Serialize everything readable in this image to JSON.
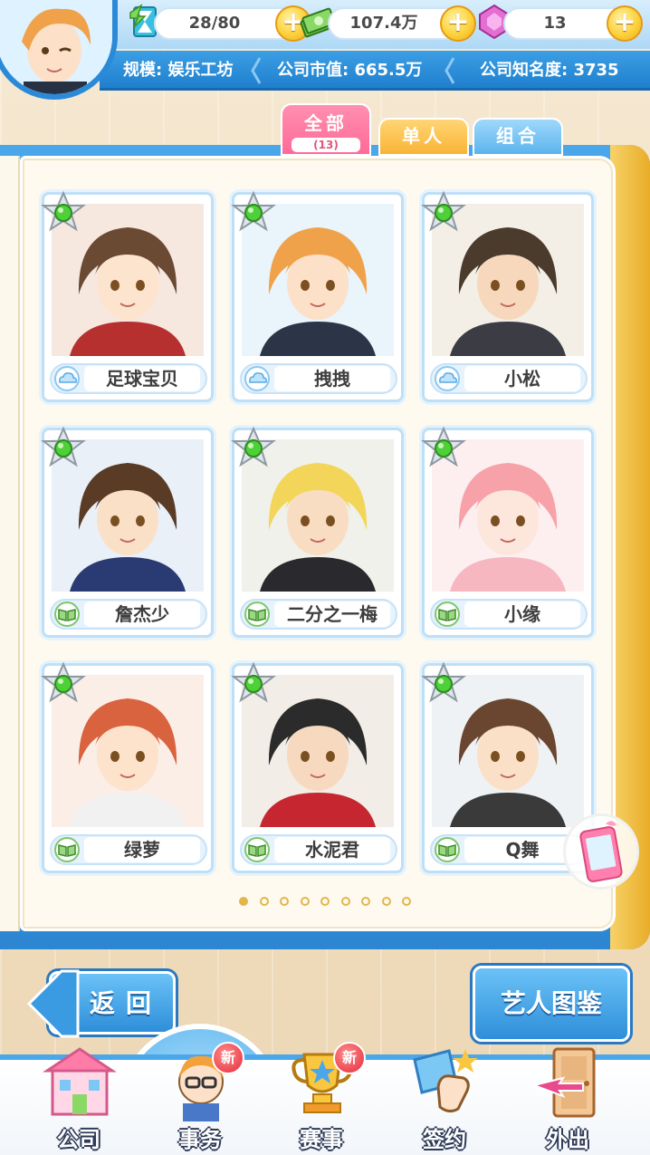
{
  "resources": {
    "energy": {
      "value": "28/80",
      "icon": "hourglass-energy-icon"
    },
    "money": {
      "value": "107.4万",
      "icon": "cash-stack-icon"
    },
    "gems": {
      "value": "13",
      "icon": "purple-gem-icon"
    }
  },
  "stats": {
    "scale": "规模: 娱乐工坊",
    "market_value": "公司市值: 665.5万",
    "popularity": "公司知名度: 3735"
  },
  "tabs": [
    {
      "label": "全部",
      "count": "(13)",
      "active": true
    },
    {
      "label": "单人",
      "active": false
    },
    {
      "label": "组合",
      "active": false
    }
  ],
  "artists": [
    {
      "name": "足球宝贝",
      "type_icon": "cloud-icon"
    },
    {
      "name": "拽拽",
      "type_icon": "cloud-icon"
    },
    {
      "name": "小松",
      "type_icon": "cloud-icon"
    },
    {
      "name": "詹杰少",
      "type_icon": "book-icon"
    },
    {
      "name": "二分之一梅",
      "type_icon": "book-icon"
    },
    {
      "name": "小缘",
      "type_icon": "book-icon"
    },
    {
      "name": "绿萝",
      "type_icon": "book-icon"
    },
    {
      "name": "水泥君",
      "type_icon": "book-icon"
    },
    {
      "name": "Q舞",
      "type_icon": "book-icon"
    }
  ],
  "pagination": {
    "total": 9,
    "current": 1
  },
  "buttons": {
    "back": "返回",
    "atlas": "艺人图鉴"
  },
  "nav": [
    {
      "label": "公司",
      "icon": "building-icon",
      "badge": ""
    },
    {
      "label": "事务",
      "icon": "manager-icon",
      "badge": "新"
    },
    {
      "label": "赛事",
      "icon": "trophy-icon",
      "badge": "新"
    },
    {
      "label": "签约",
      "icon": "contract-hand-icon",
      "badge": ""
    },
    {
      "label": "外出",
      "icon": "door-exit-icon",
      "badge": ""
    }
  ],
  "colors": {
    "primary_blue": "#2e8ed9",
    "tab_pink": "#ff6a97",
    "tab_yellow": "#f9b436",
    "tab_blue": "#5bb4ee",
    "gold": "#e2b64b"
  }
}
